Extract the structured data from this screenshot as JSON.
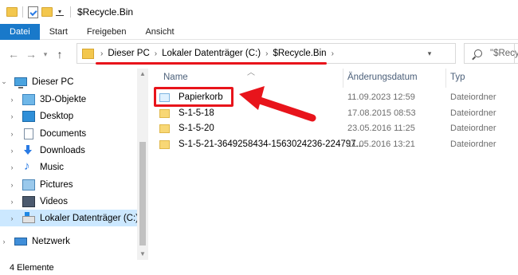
{
  "window": {
    "title": "$Recycle.Bin"
  },
  "ribbon": {
    "tabs": [
      "Datei",
      "Start",
      "Freigeben",
      "Ansicht"
    ]
  },
  "address": {
    "crumbs": [
      "Dieser PC",
      "Lokaler Datenträger (C:)",
      "$Recycle.Bin"
    ]
  },
  "search": {
    "placeholder": "\"$Recycle.Bin\" durchsuchen"
  },
  "nav": {
    "items": [
      {
        "label": "Dieser PC",
        "icon": "pc-icon"
      },
      {
        "label": "3D-Objekte",
        "icon": "3d-objects-icon"
      },
      {
        "label": "Desktop",
        "icon": "desktop-icon"
      },
      {
        "label": "Documents",
        "icon": "documents-icon"
      },
      {
        "label": "Downloads",
        "icon": "downloads-icon"
      },
      {
        "label": "Music",
        "icon": "music-icon"
      },
      {
        "label": "Pictures",
        "icon": "pictures-icon"
      },
      {
        "label": "Videos",
        "icon": "videos-icon"
      },
      {
        "label": "Lokaler Datenträger (C:)",
        "icon": "drive-icon"
      },
      {
        "label": "Netzwerk",
        "icon": "network-icon"
      }
    ]
  },
  "list": {
    "columns": {
      "name": "Name",
      "date": "Änderungsdatum",
      "type": "Typ"
    },
    "rows": [
      {
        "name": "Papierkorb",
        "date": "11.09.2023 12:59",
        "type": "Dateiordner"
      },
      {
        "name": "S-1-5-18",
        "date": "17.08.2015 08:53",
        "type": "Dateiordner"
      },
      {
        "name": "S-1-5-20",
        "date": "23.05.2016 11:25",
        "type": "Dateiordner"
      },
      {
        "name": "S-1-5-21-3649258434-1563024236-224797...",
        "date": "11.05.2016 13:21",
        "type": "Dateiordner"
      }
    ]
  },
  "status": {
    "count": "4 Elemente"
  },
  "colors": {
    "accent": "#1979ca",
    "annotation": "#e8141b",
    "selection": "#cce8ff"
  }
}
